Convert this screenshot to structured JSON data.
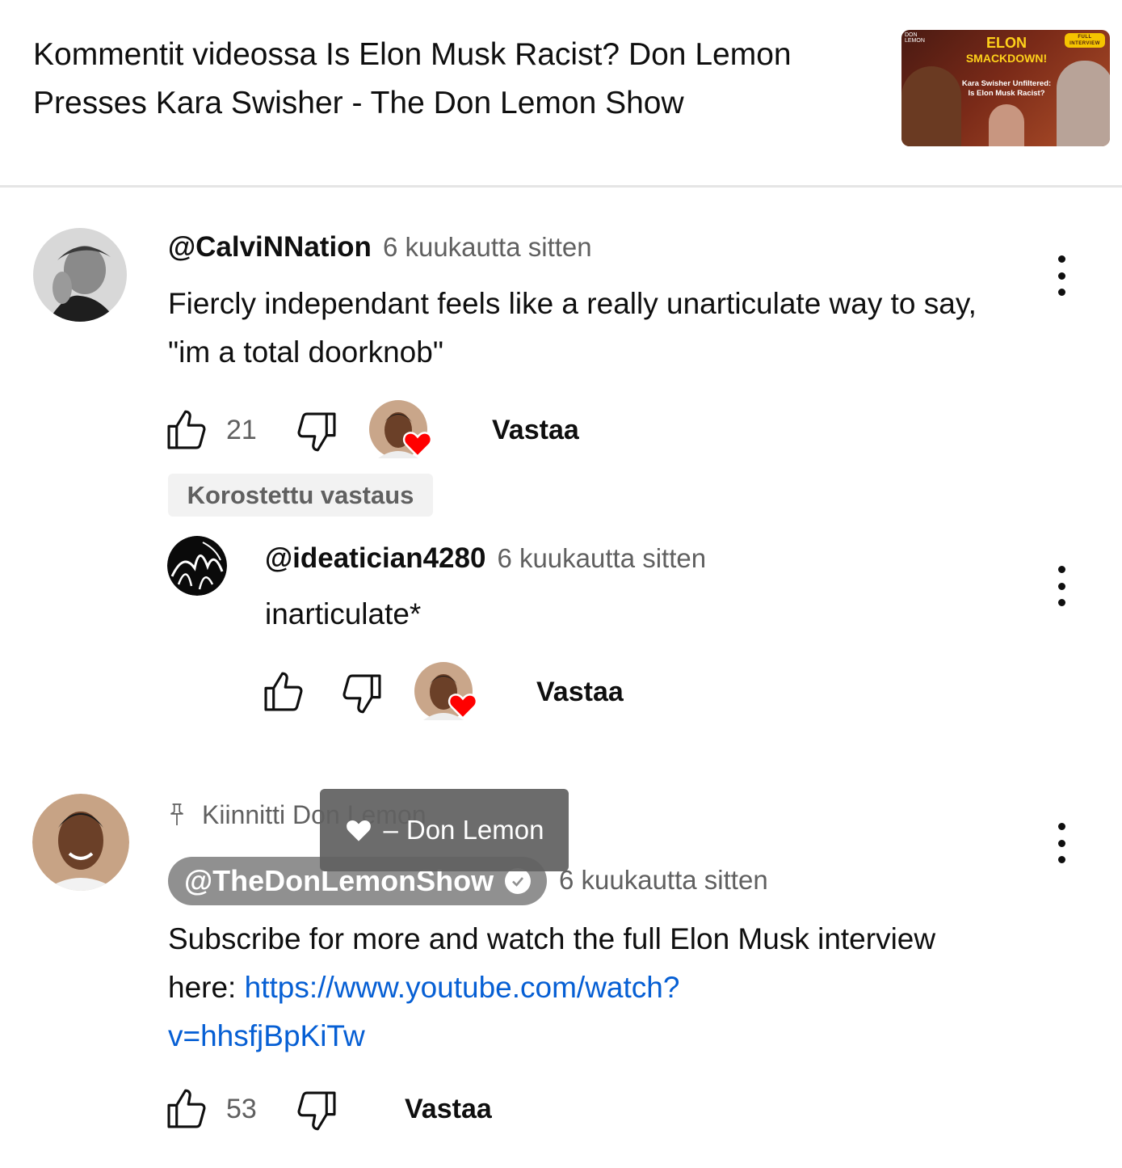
{
  "header": {
    "title": "Kommentit videossa Is Elon Musk Racist? Don Lemon Presses Kara Swisher - The Don Lemon Show",
    "thumbnail": {
      "channel_badge": "DON LEMON",
      "tag": "FULL INTERVIEW",
      "headline_line1": "ELON",
      "headline_line2": "SMACKDOWN!",
      "subtitle_line1": "Kara Swisher Unfiltered:",
      "subtitle_line2": "Is Elon Musk Racist?"
    }
  },
  "comments": [
    {
      "author": "@CalviNNation",
      "time": "6 kuukautta sitten",
      "text": "Fiercly independant feels like a really unarticulate way to say, \"im a total doorknob\"",
      "likes": "21",
      "reply_label": "Vastaa",
      "creator_hearted": true
    },
    {
      "highlight_label": "Korostettu vastaus",
      "author": "@ideatician4280",
      "time": "6 kuukautta sitten",
      "text": "inarticulate*",
      "likes": "",
      "reply_label": "Vastaa",
      "creator_hearted": true
    },
    {
      "pinned_label": "Kiinnitti Don Lemon",
      "author": "@TheDonLemonShow",
      "verified": true,
      "time": "6 kuukautta sitten",
      "text_before_link": "Subscribe for more and watch the full Elon Musk interview here: ",
      "link_line1": "https://www.youtube.com/watch?",
      "link_line2": "v=hhsfjBpKiTw",
      "likes": "53",
      "reply_label": "Vastaa"
    }
  ],
  "tooltip": {
    "dash": "–",
    "name": "Don Lemon"
  },
  "colors": {
    "link": "#065fd4",
    "secondary_text": "#606060",
    "heart": "#ff0000",
    "owner_chip": "#909090",
    "tooltip_bg": "#616161"
  },
  "icons": [
    "thumb-up-icon",
    "thumb-down-icon",
    "heart-icon",
    "kebab-menu-icon",
    "pin-icon",
    "verified-check-icon"
  ]
}
